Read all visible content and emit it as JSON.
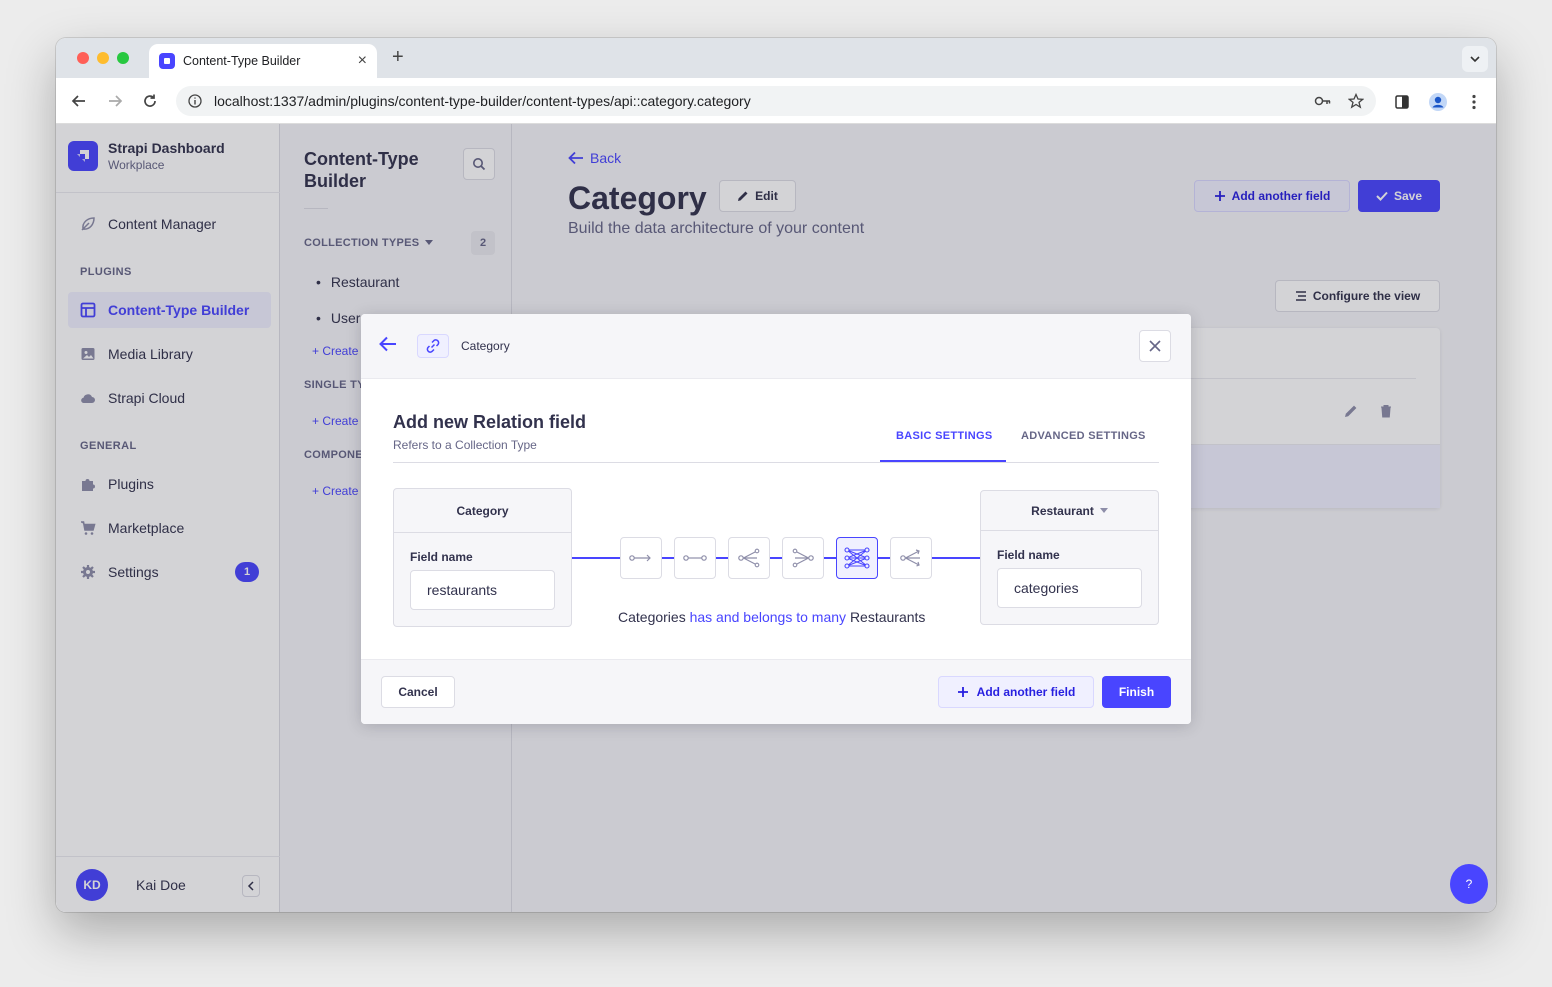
{
  "browser": {
    "tab_title": "Content-Type Builder",
    "url": "localhost:1337/admin/plugins/content-type-builder/content-types/api::category.category"
  },
  "sidebar": {
    "brand_title": "Strapi Dashboard",
    "brand_sub": "Workplace",
    "items": [
      {
        "label": "Content Manager",
        "icon": "feather-icon"
      },
      {
        "label": "Content-Type Builder",
        "icon": "layout-icon"
      },
      {
        "label": "Media Library",
        "icon": "image-icon"
      },
      {
        "label": "Strapi Cloud",
        "icon": "cloud-icon"
      },
      {
        "label": "Plugins",
        "icon": "puzzle-icon"
      },
      {
        "label": "Marketplace",
        "icon": "cart-icon"
      },
      {
        "label": "Settings",
        "icon": "gear-icon"
      }
    ],
    "section_plugins": "PLUGINS",
    "section_general": "GENERAL",
    "settings_badge": "1",
    "user_initials": "KD",
    "user_name": "Kai Doe"
  },
  "subnav": {
    "title": "Content-Type Builder",
    "collection_types_label": "COLLECTION TYPES",
    "collection_count": "2",
    "collection_items": [
      "Restaurant",
      "User"
    ],
    "create_label": "Create",
    "single_types_label": "SINGLE TY",
    "components_label": "COMPONE"
  },
  "header": {
    "back_label": "Back",
    "title": "Category",
    "edit_label": "Edit",
    "subtitle": "Build the data architecture of your content",
    "add_field_label": "Add another field",
    "save_label": "Save",
    "configure_label": "Configure the view"
  },
  "modal": {
    "breadcrumb": "Category",
    "title": "Add new Relation field",
    "subtitle": "Refers to a Collection Type",
    "tab_basic": "BASIC SETTINGS",
    "tab_advanced": "ADVANCED SETTINGS",
    "left_entity": "Category",
    "left_field_label": "Field name",
    "left_field_value": "restaurants",
    "right_entity": "Restaurant",
    "right_field_label": "Field name",
    "right_field_value": "categories",
    "sentence_start": "Categories",
    "sentence_relation": "has and belongs to many",
    "sentence_end": "Restaurants",
    "relation_types": [
      "one-way",
      "one-to-one",
      "one-to-many",
      "many-to-one",
      "many-to-many",
      "many-way"
    ],
    "selected_relation": "many-to-many",
    "cancel_label": "Cancel",
    "add_field_label": "Add another field",
    "finish_label": "Finish"
  },
  "help_label": "?",
  "colors": {
    "primary": "#4945ff",
    "primary_light": "#f0f0ff",
    "text": "#32324d",
    "muted": "#666687"
  }
}
